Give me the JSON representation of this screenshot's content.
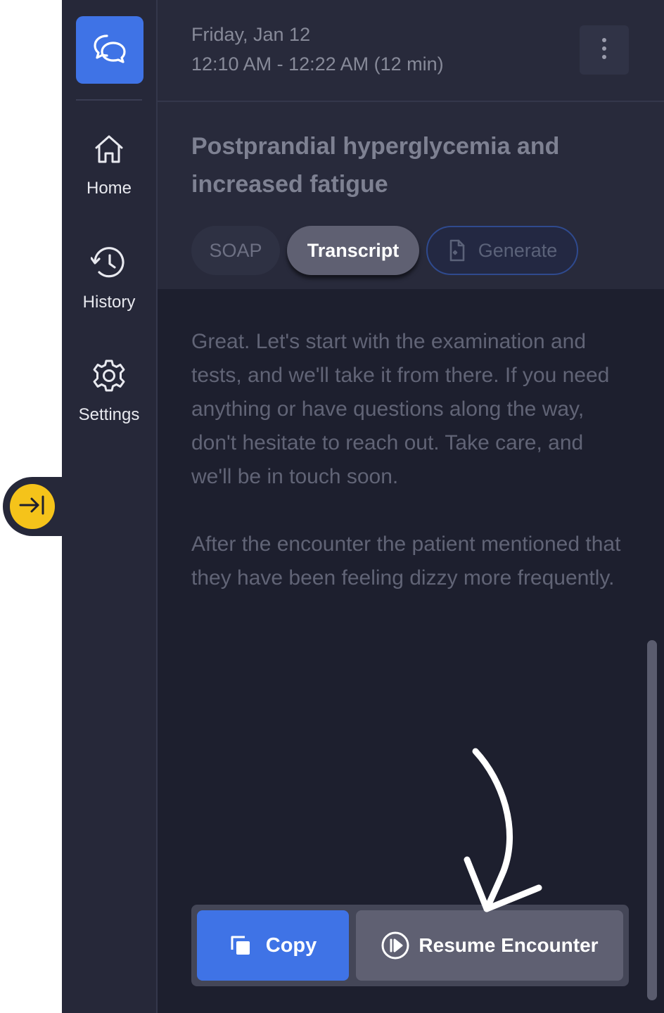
{
  "sidebar": {
    "logo_icon": "chat-bubbles-icon",
    "items": [
      {
        "label": "Home",
        "icon": "home-icon"
      },
      {
        "label": "History",
        "icon": "history-icon"
      },
      {
        "label": "Settings",
        "icon": "gear-icon"
      }
    ],
    "collapse_icon": "arrow-right-to-bar-icon"
  },
  "header": {
    "date": "Friday, Jan 12",
    "time_range": "12:10 AM - 12:22 AM (12 min)",
    "menu_icon": "kebab-menu-icon"
  },
  "encounter": {
    "title": "Postprandial hyperglycemia and increased fatigue"
  },
  "tabs": [
    {
      "label": "SOAP",
      "active": false
    },
    {
      "label": "Transcript",
      "active": true
    },
    {
      "label": "Generate",
      "icon": "document-sparkle-icon"
    }
  ],
  "transcript": {
    "paragraphs": [
      "Great. Let's start with the examination and tests, and we'll take it from there. If you need anything or have questions along the way, don't hesitate to reach out. Take care, and we'll be in touch soon.",
      "After the encounter the patient mentioned that they have been feeling dizzy more frequently."
    ]
  },
  "actions": {
    "copy_label": "Copy",
    "copy_icon": "copy-icon",
    "resume_label": "Resume Encounter",
    "resume_icon": "resume-play-icon"
  },
  "colors": {
    "accent": "#3f73e6",
    "collapse_button": "#f5c31a",
    "sidebar_bg": "#262839",
    "main_bg": "#1d1f2e"
  }
}
